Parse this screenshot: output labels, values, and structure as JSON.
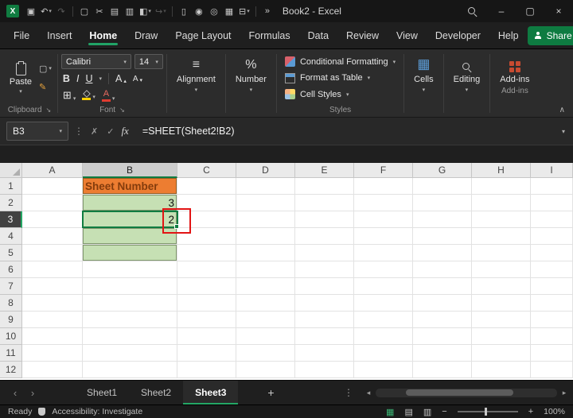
{
  "colors": {
    "excel_green": "#107C41",
    "tab_underline": "#24A765",
    "annotation_red": "#E21414",
    "header_fill_orange": "#ED7D31",
    "header_text_color": "#843C0C",
    "data_fill_green": "#C6E0B4"
  },
  "app": {
    "title": "Book2 - Excel"
  },
  "title_bar": {
    "quick_access": [
      {
        "name": "save-icon",
        "glyph": "▣"
      },
      {
        "name": "undo-icon",
        "glyph": "↶",
        "chevron": true
      },
      {
        "name": "redo-icon",
        "glyph": "↷",
        "dim": true
      },
      {
        "name": "separator"
      },
      {
        "name": "copy-icon",
        "glyph": "▢"
      },
      {
        "name": "cut-icon",
        "glyph": "✂"
      },
      {
        "name": "picture-icon",
        "glyph": "▤"
      },
      {
        "name": "insert-columns-icon",
        "glyph": "▥"
      },
      {
        "name": "fill-color-icon",
        "glyph": "◧",
        "chevron": true
      },
      {
        "name": "redo-alt-icon",
        "glyph": "↪",
        "chevron": true,
        "dim": true
      },
      {
        "name": "separator"
      },
      {
        "name": "new-sheet-icon",
        "glyph": "▯"
      },
      {
        "name": "pin-icon",
        "glyph": "◉"
      },
      {
        "name": "camera-icon",
        "glyph": "◎"
      },
      {
        "name": "table-icon",
        "glyph": "▦"
      },
      {
        "name": "query-icon",
        "glyph": "⊟",
        "chevron": true
      },
      {
        "name": "separator"
      },
      {
        "name": "overflow-icon",
        "glyph": "»"
      }
    ],
    "window_controls": [
      {
        "name": "minimize-button",
        "glyph": "–"
      },
      {
        "name": "maximize-button",
        "glyph": "▢"
      },
      {
        "name": "close-button",
        "glyph": "×"
      }
    ]
  },
  "menu_bar": {
    "items": [
      "File",
      "Insert",
      "Home",
      "Draw",
      "Page Layout",
      "Formulas",
      "Data",
      "Review",
      "View",
      "Developer",
      "Help"
    ],
    "active": "Home",
    "share_label": "Share"
  },
  "ribbon": {
    "paste_label": "Paste",
    "clipboard_label": "Clipboard",
    "font_label": "Font",
    "font_name": "Calibri",
    "font_size": "14",
    "bold": "B",
    "italic": "I",
    "underline": "U",
    "grow_font": "A",
    "shrink_font": "A",
    "font_color_letter": "A",
    "alignment_label": "Alignment",
    "number_label": "Number",
    "number_icon": "%",
    "conditional_formatting": "Conditional Formatting",
    "format_as_table": "Format as Table",
    "cell_styles": "Cell Styles",
    "styles_label": "Styles",
    "cells_label": "Cells",
    "editing_label": "Editing",
    "addins_label": "Add-ins"
  },
  "formula_bar": {
    "name_box": "B3",
    "fx_label": "fx",
    "formula": "=SHEET(Sheet2!B2)"
  },
  "grid": {
    "columns": [
      "A",
      "B",
      "C",
      "D",
      "E",
      "F",
      "G",
      "H",
      "I"
    ],
    "rows": [
      "1",
      "2",
      "3",
      "4",
      "5",
      "6",
      "7",
      "8",
      "9",
      "10",
      "11",
      "12"
    ],
    "selected_column": "B",
    "selected_row": "3",
    "selected_cell": "B3",
    "cells": {
      "B1": {
        "text": "Sheet Number",
        "fill": "#ED7D31",
        "color": "#843C0C",
        "align": "left",
        "bold": true,
        "bordered": true
      },
      "B2": {
        "text": "3",
        "fill": "#C6E0B4",
        "align": "right",
        "bordered": true
      },
      "B3": {
        "text": "2",
        "fill": "#C6E0B4",
        "align": "right",
        "bordered": true
      },
      "B4": {
        "text": "",
        "fill": "#C6E0B4",
        "bordered": true
      },
      "B5": {
        "text": "",
        "fill": "#C6E0B4",
        "bordered": true
      }
    }
  },
  "sheet_tabs": {
    "tabs": [
      "Sheet1",
      "Sheet2",
      "Sheet3"
    ],
    "active": "Sheet3",
    "add_label": "+"
  },
  "status_bar": {
    "ready": "Ready",
    "accessibility": "Accessibility: Investigate",
    "zoom_level": "100%"
  }
}
